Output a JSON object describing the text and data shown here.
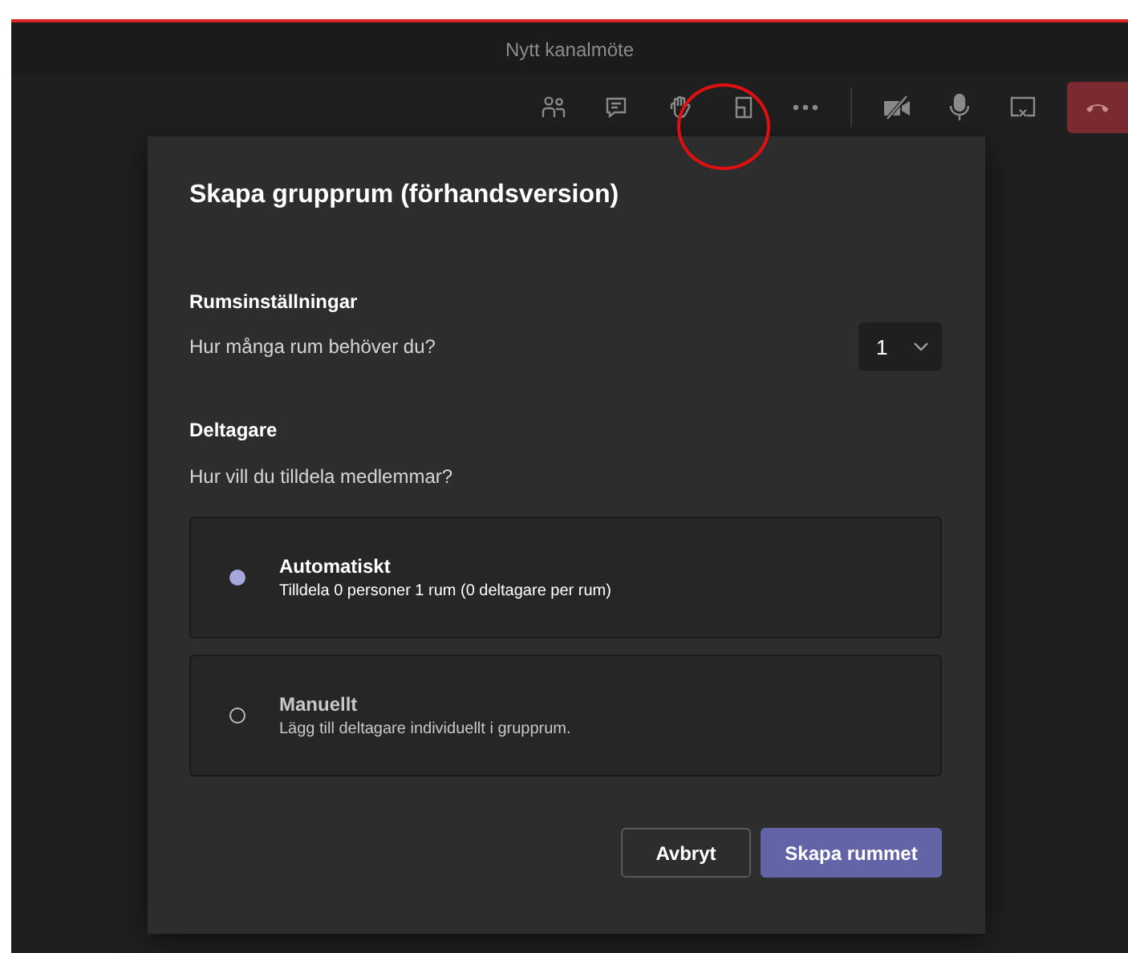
{
  "window": {
    "title": "Nytt kanalmöte"
  },
  "dialog": {
    "title": "Skapa grupprum (förhandsversion)",
    "room_settings": {
      "heading": "Rumsinställningar",
      "question": "Hur många rum behöver du?",
      "rooms": "1"
    },
    "participants": {
      "heading": "Deltagare",
      "question": "Hur vill du tilldela medlemmar?",
      "options": [
        {
          "label": "Automatiskt",
          "description": "Tilldela 0 personer 1 rum (0 deltagare per rum)",
          "selected": true
        },
        {
          "label": "Manuellt",
          "description": "Lägg till deltagare individuellt i grupprum.",
          "selected": false
        }
      ]
    },
    "buttons": [
      {
        "label": "Avbryt",
        "kind": "secondary"
      },
      {
        "label": "Skapa rummet",
        "kind": "primary"
      }
    ]
  }
}
